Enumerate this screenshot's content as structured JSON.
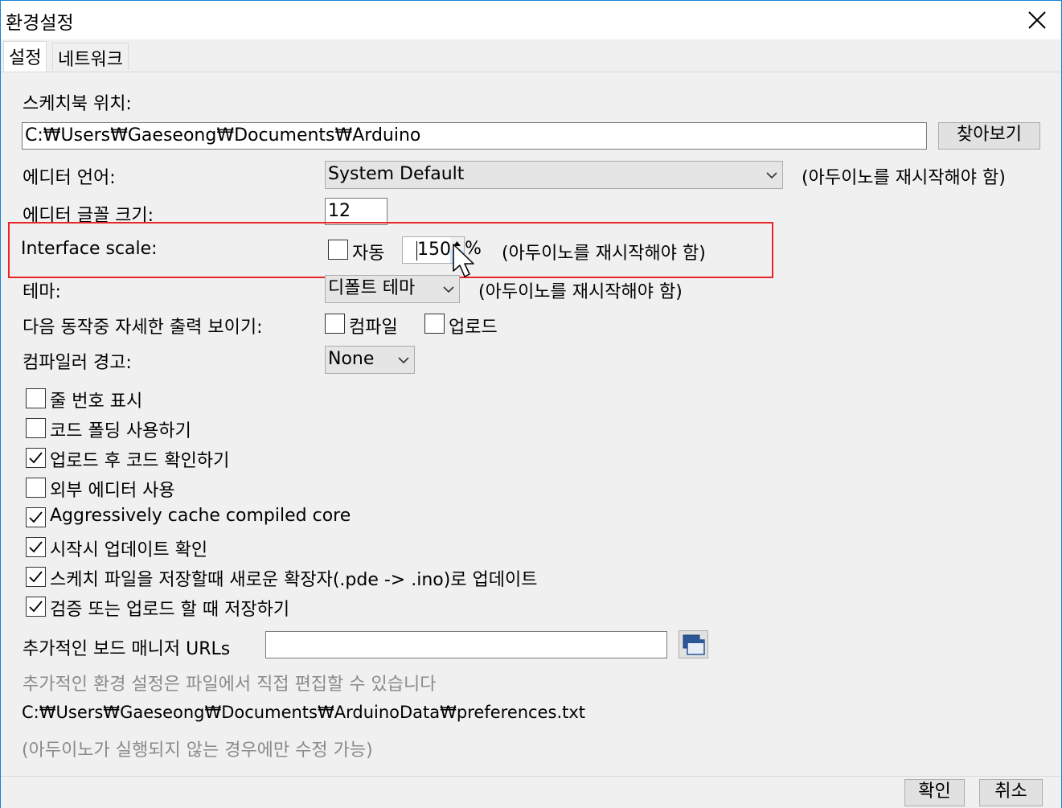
{
  "window": {
    "title": "환경설정"
  },
  "tabs": [
    {
      "label": "설정"
    },
    {
      "label": "네트워크"
    }
  ],
  "settings": {
    "sketchbook_label": "스케치북 위치:",
    "sketchbook_path": "C:₩Users₩Gaeseong₩Documents₩Arduino",
    "browse_label": "찾아보기",
    "editor_language_label": "에디터 언어:",
    "editor_language_value": "System Default",
    "editor_language_note": "(아두이노를 재시작해야 함)",
    "font_size_label": "에디터 글꼴 크기:",
    "font_size_value": "12",
    "interface_scale_label": "Interface scale:",
    "auto_label": "자동",
    "auto_checked": false,
    "scale_value": "150",
    "percent": "%",
    "scale_note": "(아두이노를 재시작해야 함)",
    "theme_label": "테마:",
    "theme_value": "디폴트 테마",
    "theme_note": "(아두이노를 재시작해야 함)",
    "verbose_label": "다음 동작중 자세한  출력 보이기:",
    "verbose_compile_label": "컴파일",
    "verbose_compile_checked": false,
    "verbose_upload_label": "업로드",
    "verbose_upload_checked": false,
    "compiler_warnings_label": "컴파일러 경고:",
    "compiler_warnings_value": "None",
    "options": [
      {
        "label": "줄 번호 표시",
        "checked": false
      },
      {
        "label": "코드 폴딩 사용하기",
        "checked": false
      },
      {
        "label": "업로드 후 코드 확인하기",
        "checked": true
      },
      {
        "label": "외부 에디터 사용",
        "checked": false
      },
      {
        "label": "Aggressively cache compiled core",
        "checked": true
      },
      {
        "label": "시작시 업데이트 확인",
        "checked": true
      },
      {
        "label": "스케치 파일을 저장할때 새로운 확장자(.pde -> .ino)로 업데이트",
        "checked": true
      },
      {
        "label": "검증 또는 업로드 할 때 저장하기",
        "checked": true
      }
    ],
    "board_urls_label": "추가적인 보드 매니저 URLs",
    "board_urls_value": "",
    "more_prefs_note": "추가적인 환경 설정은 파일에서 직접 편집할 수 있습니다",
    "prefs_path": "C:₩Users₩Gaeseong₩Documents₩ArduinoData₩preferences.txt",
    "edit_note": "(아두이노가 실행되지 않는 경우에만 수정 가능)"
  },
  "footer": {
    "ok_label": "확인",
    "cancel_label": "취소"
  },
  "colors": {
    "highlight": "#e8262a",
    "window_border": "#1883d7",
    "panel_bg": "#f0f0f0"
  },
  "icons": {
    "close": "close-icon",
    "board_urls": "window-list-icon",
    "cursor": "mouse-pointer-icon"
  }
}
